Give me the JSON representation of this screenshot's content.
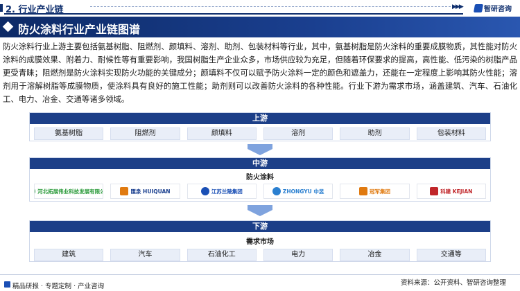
{
  "header": {
    "section": "2. 行业产业链",
    "brand": "智研咨询"
  },
  "title": "防火涂料行业产业链图谱",
  "intro": "防火涂料行业上游主要包括氨基树脂、阻燃剂、颜填料、溶剂、助剂、包装材料等行业，其中，氨基树脂是防火涂料的重要成膜物质，其性能对防火涂料的成膜效果、附着力、耐候性等有重要影响，我国树脂生产企业众多，市场供应较为充足，但随着环保要求的提高，高性能、低污染的树脂产品更受青睐；阻燃剂是防火涂料实现防火功能的关键成分；颜填料不仅可以赋予防火涂料一定的颜色和遮盖力，还能在一定程度上影响其防火性能；溶剂用于溶解树脂等成膜物质，使涂料具有良好的施工性能；助剂则可以改善防火涂料的各种性能。行业下游为需求市场，涵盖建筑、汽车、石油化工、电力、冶金、交通等诸多领域。",
  "upstream": {
    "label": "上游",
    "items": [
      "氨基树脂",
      "阻燃剂",
      "颜填料",
      "溶剂",
      "助剂",
      "包装材料"
    ]
  },
  "midstream": {
    "label": "中游",
    "sublabel": "防火涂料",
    "logos": [
      {
        "text": "河北拓展伟业科技发展有限公司",
        "color": "#2a9a3a",
        "icon": "green-leaf-logo"
      },
      {
        "text": "匯泉 HUIQUAN",
        "color": "#1a3f8f",
        "icon": "orange-block-logo"
      },
      {
        "text": "江苏兰陵集团",
        "color": "#1a4fb5",
        "icon": "blue-eye-logo"
      },
      {
        "text": "ZHONGYU 中昱",
        "color": "#2a7fd0",
        "icon": "blue-wave-logo"
      },
      {
        "text": "冠军集团",
        "color": "#e07a10",
        "icon": "orange-square-logo"
      },
      {
        "text": "科建 KEJIAN",
        "color": "#c0262a",
        "icon": "red-k-logo"
      }
    ]
  },
  "downstream": {
    "label": "下游",
    "sublabel": "需求市场",
    "items": [
      "建筑",
      "汽车",
      "石油化工",
      "电力",
      "冶金",
      "交通等"
    ]
  },
  "footer": {
    "left": "精品研报 · 专题定制 · 产业咨询",
    "right": "资料来源：公开资料、智研咨询整理"
  },
  "colors": {
    "navy": "#0f2f6e",
    "tier_head": "#1c3f88",
    "arrow": "#7fa3de",
    "cell_bg": "#e9eef8"
  }
}
